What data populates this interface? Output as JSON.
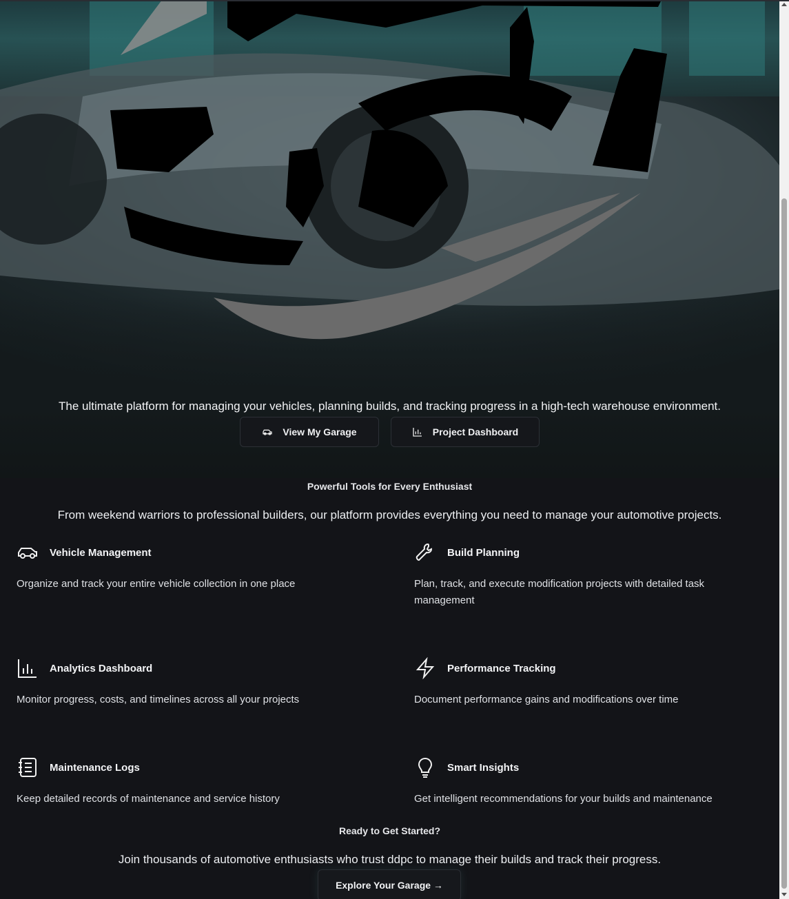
{
  "hero": {
    "tagline": "The ultimate platform for managing your vehicles, planning builds, and tracking progress in a high-tech warehouse environment.",
    "primary_button": "View My Garage",
    "secondary_button": "Project Dashboard"
  },
  "features": {
    "title": "Powerful Tools for Every Enthusiast",
    "subtitle": "From weekend warriors to professional builders, our platform provides everything you need to manage your automotive projects.",
    "items": [
      {
        "icon": "car-icon",
        "title": "Vehicle Management",
        "description": "Organize and track your entire vehicle collection in one place"
      },
      {
        "icon": "wrench-icon",
        "title": "Build Planning",
        "description": "Plan, track, and execute modification projects with detailed task management"
      },
      {
        "icon": "bar-chart-icon",
        "title": "Analytics Dashboard",
        "description": "Monitor progress, costs, and timelines across all your projects"
      },
      {
        "icon": "lightning-icon",
        "title": "Performance Tracking",
        "description": "Document performance gains and modifications over time"
      },
      {
        "icon": "notebook-icon",
        "title": "Maintenance Logs",
        "description": "Keep detailed records of maintenance and service history"
      },
      {
        "icon": "lightbulb-icon",
        "title": "Smart Insights",
        "description": "Get intelligent recommendations for your builds and maintenance"
      }
    ]
  },
  "cta": {
    "title": "Ready to Get Started?",
    "subtitle": "Join thousands of automotive enthusiasts who trust ddpc to manage their builds and track their progress.",
    "button": "Explore Your Garage →"
  },
  "colors": {
    "background": "#131418",
    "button_bg": "#15171b",
    "accent_teal": "#2f7a7a",
    "logo_gray": "#6b6b6b"
  }
}
